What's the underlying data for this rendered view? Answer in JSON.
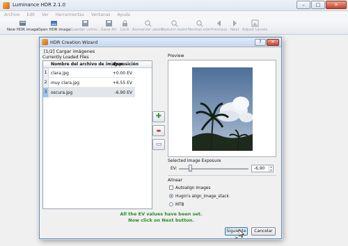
{
  "app": {
    "title": "Luminance HDR 2.1.0",
    "menu": [
      "Archivo",
      "Edit",
      "Ver",
      "Herramientas",
      "Ventanas",
      "Ayuda"
    ],
    "toolbar": [
      {
        "label": "New HDR image",
        "icon": "new-hdr-icon",
        "enabled": true
      },
      {
        "label": "Open HDR image",
        "icon": "open-hdr-icon",
        "enabled": true
      },
      {
        "label": "Guardar como...",
        "icon": "save-as-icon",
        "enabled": false
      },
      {
        "label": "Save All",
        "icon": "save-all-icon",
        "enabled": false
      },
      {
        "label": "Lock",
        "icon": "lock-icon",
        "enabled": false
      },
      {
        "label": "Aumentar zoom",
        "icon": "zoom-in-icon",
        "enabled": false
      },
      {
        "label": "Reducir zoom",
        "icon": "zoom-out-icon",
        "enabled": false
      },
      {
        "label": "Normal size",
        "icon": "normal-size-icon",
        "enabled": false
      },
      {
        "label": "Previous",
        "icon": "previous-icon",
        "enabled": false
      },
      {
        "label": "Next",
        "icon": "next-icon",
        "enabled": false
      },
      {
        "label": "Adjust Levels",
        "icon": "adjust-levels-icon",
        "enabled": false
      }
    ]
  },
  "dialog": {
    "title": "HDR Creation Wizard",
    "step": "[1/2] Cargar imágenes",
    "loaded_files_label": "Currently Loaded Files",
    "preview_label": "Preview",
    "table": {
      "columns": [
        "Nombre del archivo de imagen",
        "Exposición"
      ],
      "rows": [
        {
          "num": "1",
          "name": "clara.jpg",
          "ev": "+0.00 EV"
        },
        {
          "num": "2",
          "name": "muy clara.jpg",
          "ev": "+6.55 EV"
        },
        {
          "num": "3",
          "name": "oscura.jpg",
          "ev": "-6.90 EV"
        }
      ],
      "selected_row": 3
    },
    "side_buttons": [
      {
        "icon": "add-icon",
        "glyph": "✚"
      },
      {
        "icon": "remove-icon",
        "glyph": "▬"
      },
      {
        "icon": "clear-list-icon",
        "glyph": "▭"
      }
    ],
    "exposure": {
      "title": "Selected Image Exposure",
      "ev_label": "EV:",
      "ev_value": "-6,90"
    },
    "align": {
      "title": "Alinear",
      "autoalign_label": "Autoalign images",
      "autoalign_checked": false,
      "option1": "Hugin's align_image_stack",
      "option2": "MTB",
      "selected": "option1"
    },
    "status_line1": "All the EV values have been set.",
    "status_line2": "Now click on Next button.",
    "next_label": "Siguiente >",
    "cancel_label": "Cancelar",
    "status_color": "#2a8a2a"
  }
}
